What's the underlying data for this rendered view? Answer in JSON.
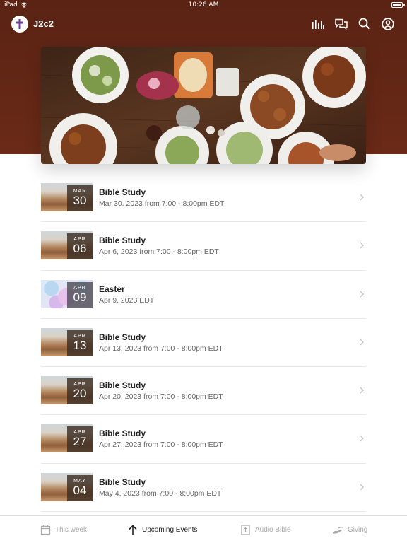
{
  "status": {
    "device": "iPad",
    "time": "10:26 AM"
  },
  "app": {
    "title": "J2c2"
  },
  "header_icons": [
    "bars-chart-icon",
    "chat-icon",
    "search-icon",
    "profile-icon"
  ],
  "colors": {
    "header": "#5a2314",
    "divider": "#e8e8e8"
  },
  "events": [
    {
      "month": "MAR",
      "day": "30",
      "title": "Bible Study",
      "subtitle": "Mar 30, 2023 from 7:00 - 8:00pm EDT",
      "thumb": "desert"
    },
    {
      "month": "APR",
      "day": "06",
      "title": "Bible Study",
      "subtitle": "Apr 6, 2023 from 7:00 - 8:00pm EDT",
      "thumb": "desert"
    },
    {
      "month": "APR",
      "day": "09",
      "title": "Easter",
      "subtitle": "Apr 9, 2023 EDT",
      "thumb": "easter"
    },
    {
      "month": "APR",
      "day": "13",
      "title": "Bible Study",
      "subtitle": "Apr 13, 2023 from 7:00 - 8:00pm EDT",
      "thumb": "desert"
    },
    {
      "month": "APR",
      "day": "20",
      "title": "Bible Study",
      "subtitle": "Apr 20, 2023 from 7:00 - 8:00pm EDT",
      "thumb": "desert"
    },
    {
      "month": "APR",
      "day": "27",
      "title": "Bible Study",
      "subtitle": "Apr 27, 2023 from 7:00 - 8:00pm EDT",
      "thumb": "desert"
    },
    {
      "month": "MAY",
      "day": "04",
      "title": "Bible Study",
      "subtitle": "May 4, 2023 from 7:00 - 8:00pm EDT",
      "thumb": "desert"
    }
  ],
  "tabs": [
    {
      "label": "This week",
      "icon": "calendar-icon",
      "active": false
    },
    {
      "label": "Upcoming Events",
      "icon": "arrow-up-icon",
      "active": true
    },
    {
      "label": "Audio Bible",
      "icon": "bible-icon",
      "active": false
    },
    {
      "label": "Giving",
      "icon": "giving-hand-icon",
      "active": false
    }
  ]
}
